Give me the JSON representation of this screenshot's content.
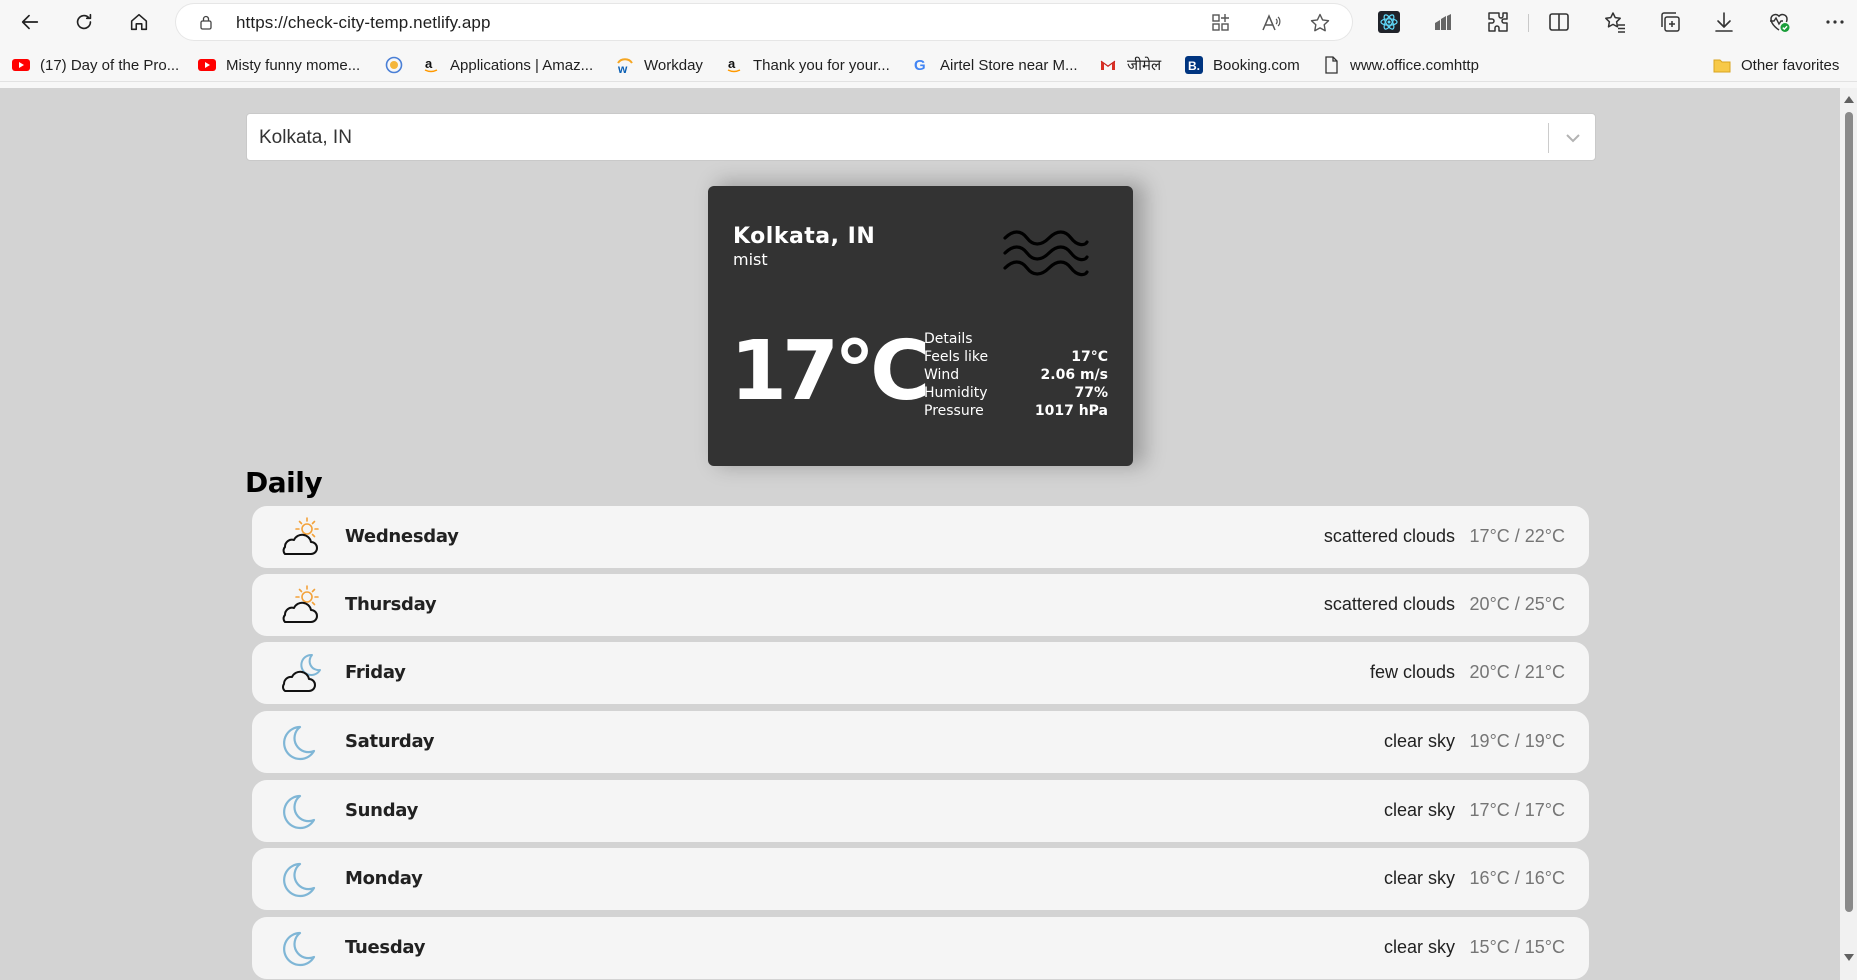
{
  "browser": {
    "url": "https://check-city-temp.netlify.app",
    "bookmarks": [
      {
        "label": "(17) Day of the Pro...",
        "icon": "youtube-icon"
      },
      {
        "label": "Misty funny mome...",
        "icon": "youtube-icon"
      },
      {
        "label": "",
        "icon": "circle-logo-icon"
      },
      {
        "label": "Applications | Amaz...",
        "icon": "amazon-icon"
      },
      {
        "label": "Workday",
        "icon": "workday-icon"
      },
      {
        "label": "Thank you for your...",
        "icon": "amazon-icon"
      },
      {
        "label": "Airtel Store near M...",
        "icon": "google-icon"
      },
      {
        "label": "जीमेल",
        "icon": "gmail-icon"
      },
      {
        "label": "Booking.com",
        "icon": "booking-icon"
      },
      {
        "label": "www.office.comhttp",
        "icon": "page-icon"
      }
    ],
    "other_favorites": "Other favorites"
  },
  "search": {
    "value": "Kolkata, IN"
  },
  "current": {
    "city": "Kolkata, IN",
    "description": "mist",
    "icon": "mist-icon",
    "temperature": "17°C",
    "details_title": "Details",
    "details": [
      {
        "label": "Feels like",
        "value": "17°C"
      },
      {
        "label": "Wind",
        "value": "2.06 m/s"
      },
      {
        "label": "Humidity",
        "value": "77%"
      },
      {
        "label": "Pressure",
        "value": "1017 hPa"
      }
    ]
  },
  "daily": {
    "title": "Daily",
    "days": [
      {
        "day": "Wednesday",
        "condition": "scattered clouds",
        "range": "17°C / 22°C",
        "icon": "cloud-sun-icon"
      },
      {
        "day": "Thursday",
        "condition": "scattered clouds",
        "range": "20°C / 25°C",
        "icon": "cloud-sun-icon"
      },
      {
        "day": "Friday",
        "condition": "few clouds",
        "range": "20°C / 21°C",
        "icon": "cloud-moon-icon"
      },
      {
        "day": "Saturday",
        "condition": "clear sky",
        "range": "19°C / 19°C",
        "icon": "moon-icon"
      },
      {
        "day": "Sunday",
        "condition": "clear sky",
        "range": "17°C / 17°C",
        "icon": "moon-icon"
      },
      {
        "day": "Monday",
        "condition": "clear sky",
        "range": "16°C / 16°C",
        "icon": "moon-icon"
      },
      {
        "day": "Tuesday",
        "condition": "clear sky",
        "range": "15°C / 15°C",
        "icon": "moon-icon"
      }
    ]
  },
  "colors": {
    "page_bg": "#d3d3d3",
    "card_bg": "#333333",
    "row_bg": "#f5f5f5",
    "moon": "#7fb6d6",
    "sun": "#f3a23a"
  }
}
